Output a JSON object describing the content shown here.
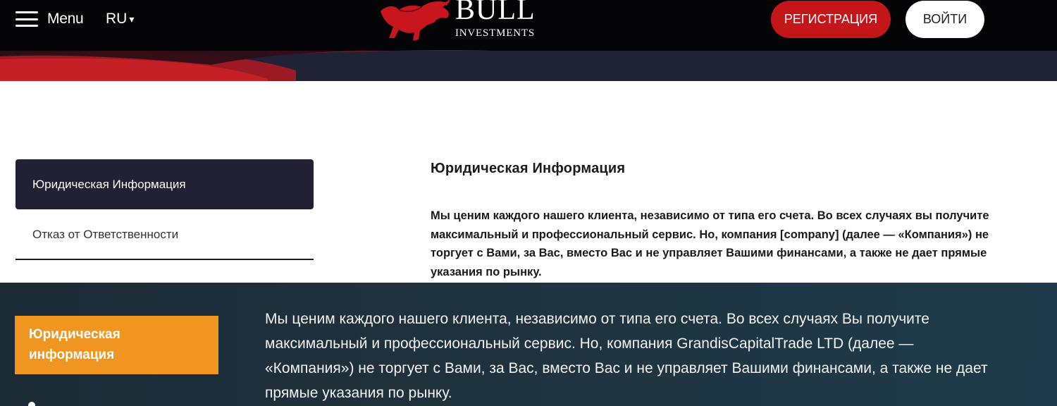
{
  "header": {
    "menu_label": "Menu",
    "lang": "RU",
    "lang_caret": "▾",
    "logo_main": "BULL",
    "logo_sub": "INVESTMENTS",
    "register_label": "РЕГИСТРАЦИЯ",
    "login_label": "ВОЙТИ"
  },
  "colors": {
    "brand_red": "#c41519",
    "header_black": "#050507",
    "sidebar_active": "#222133",
    "accent_orange": "#f0951f",
    "lower_bg": "#1f3440"
  },
  "legal": {
    "sidebar": [
      {
        "label": "Юридическая Информация",
        "active": true
      },
      {
        "label": "Отказ от Ответственности",
        "active": false
      }
    ],
    "title": "Юридическая Информация",
    "text": "Мы ценим каждого нашего клиента, независимо от типа его счета. Во всех случаях вы получите максимальный и профессиональный сервис. Но, компания [company] (далее — «Компания») не торгует с Вами, за Вас, вместо Вас и не управляет Вашими финансами, а также не дает прямые указания по рынку."
  },
  "second_site": {
    "sidebar_active": "Юридическая информация",
    "text": "Мы ценим каждого нашего клиента, независимо от типа его счета. Во всех случаях Вы получите максимальный и профессиональный сервис. Но, компания GrandisCapitalTrade LTD (далее — «Компания») не торгует с Вами, за Вас, вместо Вас и не управляет Вашими финансами, а также не дает прямые указания по рынку."
  }
}
